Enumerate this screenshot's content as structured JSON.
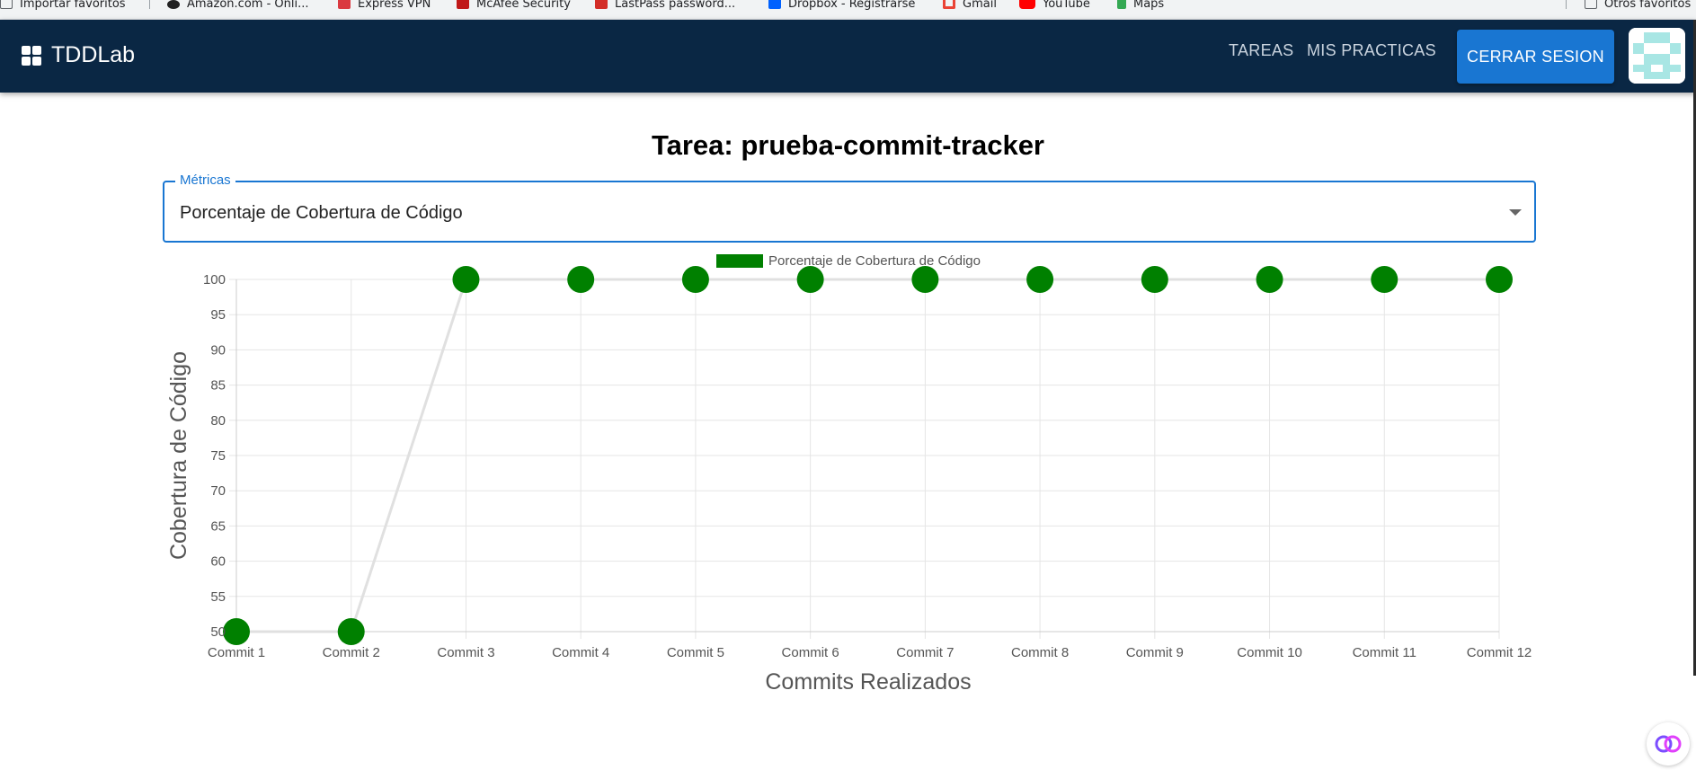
{
  "bookmarks": [
    {
      "label": "Importar favoritos",
      "icon": "import-icon",
      "color": "#5f6368"
    },
    {
      "label": "Amazon.com - Onli...",
      "icon": "amazon-icon",
      "color": "#222222"
    },
    {
      "label": "Express VPN",
      "icon": "expressvpn-icon",
      "color": "#da3940"
    },
    {
      "label": "McAfee Security",
      "icon": "mcafee-icon",
      "color": "#c01818"
    },
    {
      "label": "LastPass password...",
      "icon": "lastpass-icon",
      "color": "#d32d27"
    },
    {
      "label": "Dropbox - Registrarse",
      "icon": "dropbox-icon",
      "color": "#0061fe"
    },
    {
      "label": "Gmail",
      "icon": "gmail-icon",
      "color": "#ea4335"
    },
    {
      "label": "YouTube",
      "icon": "youtube-icon",
      "color": "#ff0000"
    },
    {
      "label": "Maps",
      "icon": "maps-icon",
      "color": "#34a853"
    },
    {
      "label": "Otros favoritos",
      "icon": "folder-icon",
      "color": "#5f6368"
    }
  ],
  "header": {
    "brand": "TDDLab",
    "nav": [
      "TAREAS",
      "MIS PRACTICAS"
    ],
    "logout": "CERRAR SESION",
    "colors": {
      "bar": "#0a2744",
      "button": "#1976d2"
    }
  },
  "main": {
    "title": "Tarea: prueba-commit-tracker",
    "select": {
      "label": "Métricas",
      "value": "Porcentaje de Cobertura de Código"
    }
  },
  "chart_data": {
    "type": "line",
    "categories": [
      "Commit 1",
      "Commit 2",
      "Commit 3",
      "Commit 4",
      "Commit 5",
      "Commit 6",
      "Commit 7",
      "Commit 8",
      "Commit 9",
      "Commit 10",
      "Commit 11",
      "Commit 12"
    ],
    "series": [
      {
        "name": "Porcentaje de Cobertura de Código",
        "values": [
          50,
          50,
          100,
          100,
          100,
          100,
          100,
          100,
          100,
          100,
          100,
          100
        ],
        "color": "#008000"
      }
    ],
    "xlabel": "Commits Realizados",
    "ylabel": "Cobertura de Código",
    "ylim": [
      50,
      100
    ],
    "yticks": [
      50,
      55,
      60,
      65,
      70,
      75,
      80,
      85,
      90,
      95,
      100
    ],
    "line_color": "#e0e0e0",
    "grid": true,
    "legend": "top-center"
  }
}
